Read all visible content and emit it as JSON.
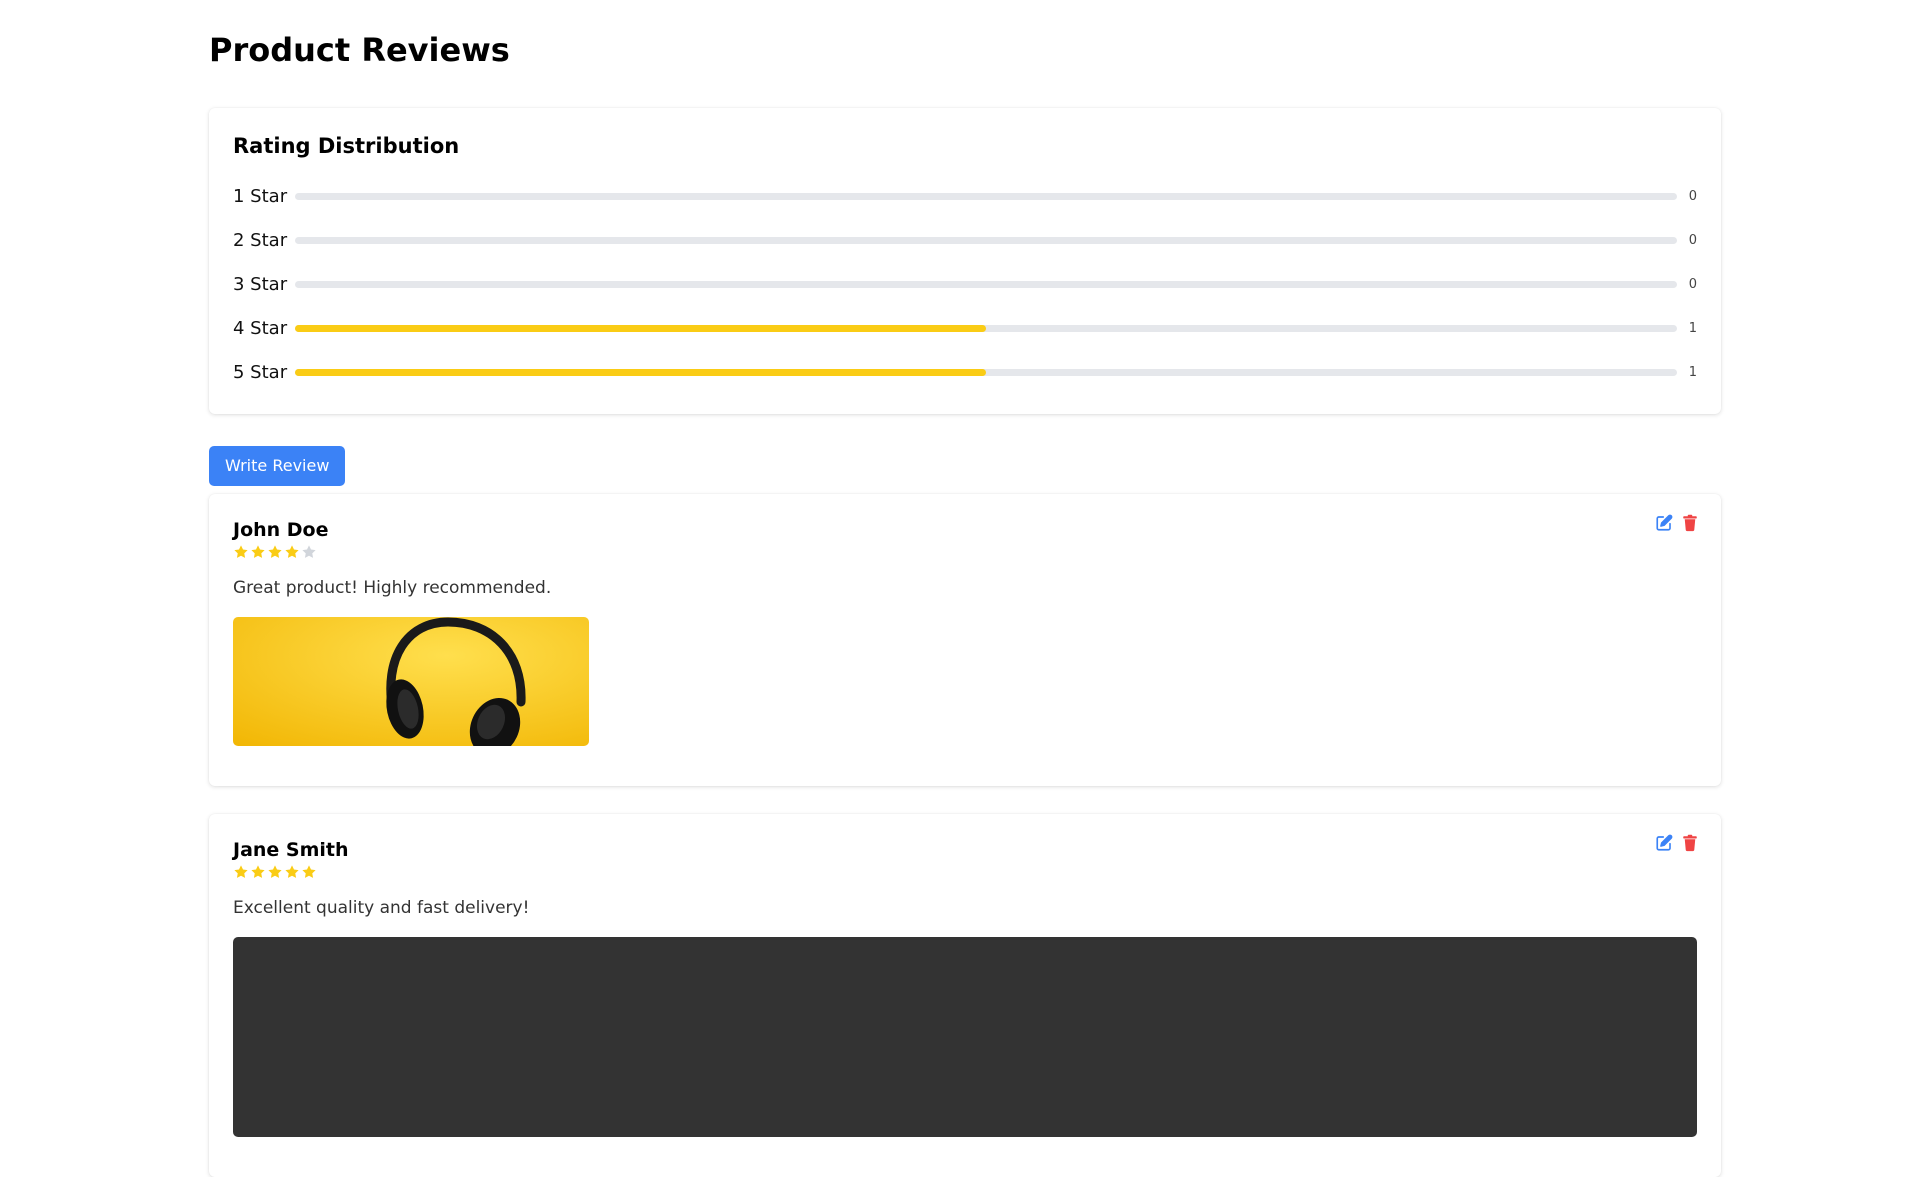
{
  "page": {
    "title": "Product Reviews"
  },
  "distribution": {
    "title": "Rating Distribution",
    "max_count": 2,
    "rows": [
      {
        "label": "1 Star",
        "count": 0
      },
      {
        "label": "2 Star",
        "count": 0
      },
      {
        "label": "3 Star",
        "count": 0
      },
      {
        "label": "4 Star",
        "count": 1
      },
      {
        "label": "5 Star",
        "count": 1
      }
    ]
  },
  "actions": {
    "write_review_label": "Write Review"
  },
  "reviews": [
    {
      "name": "John Doe",
      "rating": 4,
      "text": "Great product! Highly recommended.",
      "image": "yellow-headphones-photo"
    },
    {
      "name": "Jane Smith",
      "rating": 5,
      "text": "Excellent quality and fast delivery!",
      "image": "dark-photo"
    }
  ],
  "colors": {
    "accent": "#3b82f6",
    "star_filled": "#facc15",
    "star_empty": "#d1d5db",
    "edit_icon": "#3b82f6",
    "delete_icon": "#ef4444",
    "bar_track": "#e5e7eb"
  },
  "icons": {
    "edit": "edit-icon",
    "delete": "trash-icon",
    "star": "star-icon"
  }
}
